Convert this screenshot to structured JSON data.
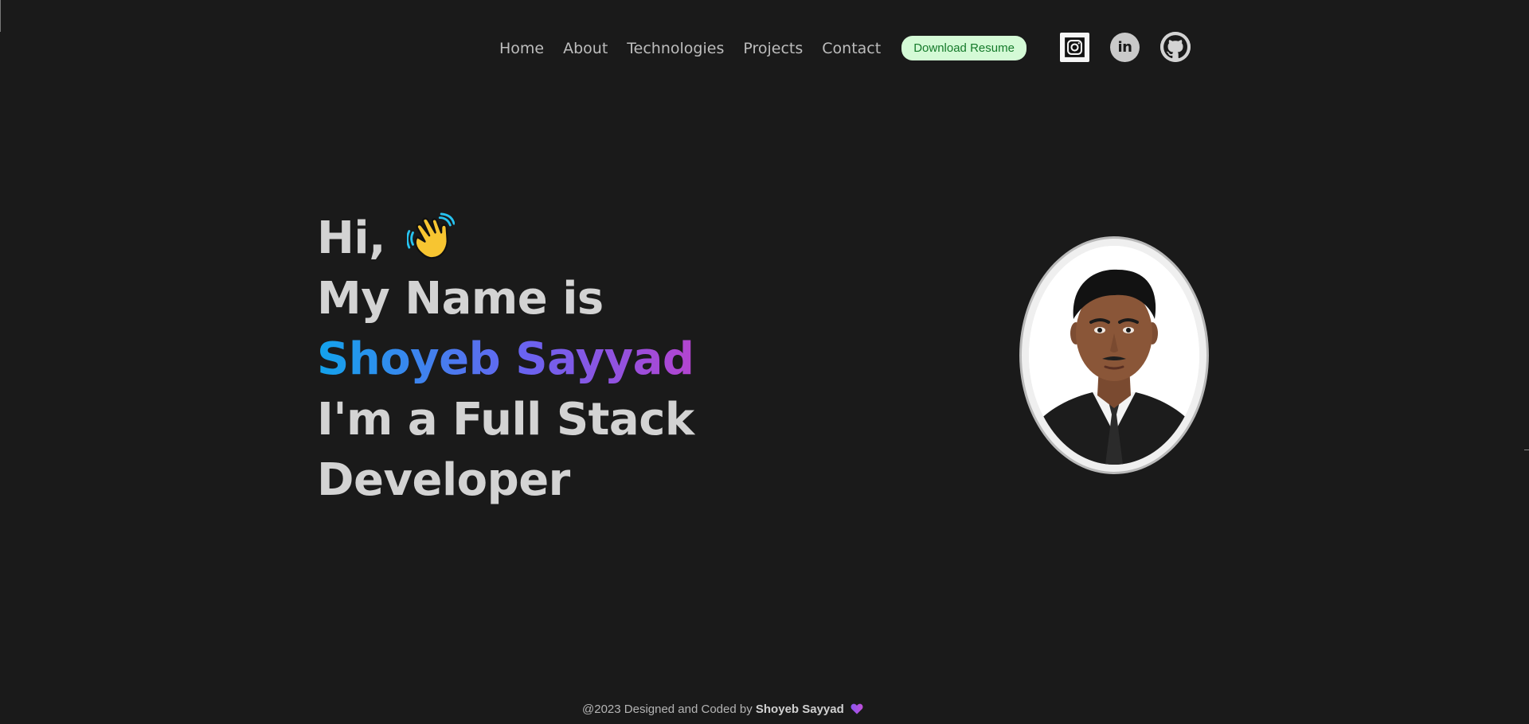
{
  "nav": {
    "links": [
      "Home",
      "About",
      "Technologies",
      "Projects",
      "Contact"
    ],
    "resume_label": "Download Resume"
  },
  "socials": {
    "instagram_icon": "instagram-icon",
    "linkedin_icon": "linkedin-icon",
    "linkedin_text": "in",
    "github_icon": "github-icon"
  },
  "hero": {
    "greeting": "Hi,",
    "wave_icon": "waving-hand-icon",
    "line2": "My Name is",
    "name": "Shoyeb Sayyad",
    "line4": "I'm a Full Stack",
    "line5": "Developer"
  },
  "photo": {
    "alt": "profile-photo"
  },
  "footer": {
    "prefix": "@2023 Designed and Coded by",
    "author": "Shoyeb Sayyad",
    "heart_icon": "heart-icon"
  },
  "colors": {
    "background": "#1a1a1a",
    "text": "#d3d3d3",
    "resume_bg": "#d4fad6",
    "resume_text": "#157a2a",
    "gradient_start": "#12a3ec",
    "gradient_end": "#b444d0"
  }
}
